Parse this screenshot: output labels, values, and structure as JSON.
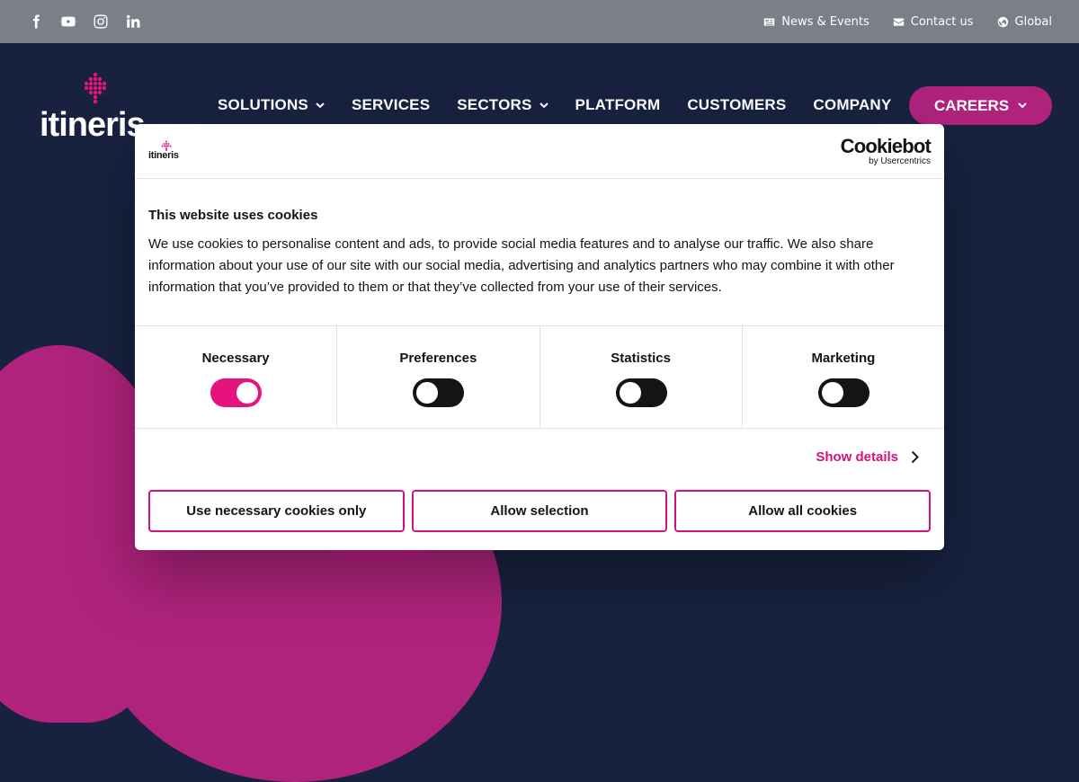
{
  "topbar": {
    "social": [
      {
        "icon": "facebook-icon"
      },
      {
        "icon": "youtube-icon"
      },
      {
        "icon": "instagram-icon"
      },
      {
        "icon": "linkedin-icon"
      }
    ],
    "links": [
      {
        "icon": "newspaper-icon",
        "label": "News & Events"
      },
      {
        "icon": "envelope-icon",
        "label": "Contact us"
      },
      {
        "icon": "globe-icon",
        "label": "Global"
      }
    ]
  },
  "header": {
    "logo_text": "itineris",
    "nav": [
      {
        "label": "SOLUTIONS",
        "has_dropdown": true
      },
      {
        "label": "SERVICES",
        "has_dropdown": false
      },
      {
        "label": "SECTORS",
        "has_dropdown": true
      },
      {
        "label": "PLATFORM",
        "has_dropdown": false
      },
      {
        "label": "CUSTOMERS",
        "has_dropdown": false
      },
      {
        "label": "COMPANY",
        "has_dropdown": false
      }
    ],
    "careers_label": "CAREERS"
  },
  "colors": {
    "brand_magenta": "#b0237d",
    "toggle_on": "#e5137e",
    "navy": "#18223f",
    "topbar": "#7b7f88"
  },
  "cookie_dialog": {
    "logo_text": "itineris",
    "provider": "Cookiebot",
    "provider_sub": "by Usercentrics",
    "title": "This website uses cookies",
    "body": "We use cookies to personalise content and ads, to provide social media features and to analyse our traffic. We also share information about your use of our site with our social media, advertising and analytics partners who may combine it with other information that you’ve provided to them or that they’ve collected from your use of their services.",
    "categories": [
      {
        "label": "Necessary",
        "enabled": true
      },
      {
        "label": "Preferences",
        "enabled": false
      },
      {
        "label": "Statistics",
        "enabled": false
      },
      {
        "label": "Marketing",
        "enabled": false
      }
    ],
    "show_details": "Show details",
    "buttons": {
      "necessary_only": "Use necessary cookies only",
      "allow_selection": "Allow selection",
      "allow_all": "Allow all cookies"
    }
  }
}
